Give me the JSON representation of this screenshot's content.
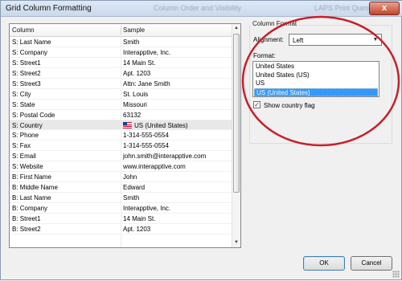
{
  "window": {
    "title": "Grid Column Formatting",
    "background_titles": [
      "Column Order and Visibility",
      "LAPS Print Quest"
    ],
    "close_symbol": "x"
  },
  "grid": {
    "headers": {
      "column": "Column",
      "sample": "Sample"
    },
    "rows": [
      {
        "column": "S: Last Name",
        "sample": "Smith"
      },
      {
        "column": "S: Company",
        "sample": "Interapptive, Inc."
      },
      {
        "column": "S: Street1",
        "sample": "14 Main St."
      },
      {
        "column": "S: Street2",
        "sample": "Apt. 1203"
      },
      {
        "column": "S: Street3",
        "sample": "Attn: Jane Smith"
      },
      {
        "column": "S: City",
        "sample": "St. Louis"
      },
      {
        "column": "S: State",
        "sample": "Missouri"
      },
      {
        "column": "S: Postal Code",
        "sample": "63132"
      },
      {
        "column": "S: Country",
        "sample": "US (United States)",
        "flag": "us-flag-icon"
      },
      {
        "column": "S: Phone",
        "sample": "1-314-555-0554"
      },
      {
        "column": "S: Fax",
        "sample": "1-314-555-0554"
      },
      {
        "column": "S: Email",
        "sample": "john.smith@interapptive.com"
      },
      {
        "column": "S: Website",
        "sample": "www.interapptive.com"
      },
      {
        "column": "B: First Name",
        "sample": "John"
      },
      {
        "column": "B: Middle Name",
        "sample": "Edward"
      },
      {
        "column": "B: Last Name",
        "sample": "Smith"
      },
      {
        "column": "B: Company",
        "sample": "Interapptive, Inc."
      },
      {
        "column": "B: Street1",
        "sample": "14 Main St."
      },
      {
        "column": "B: Street2",
        "sample": "Apt. 1203"
      }
    ],
    "selected_row": "S: Country"
  },
  "column_format": {
    "group_title": "Column Format",
    "alignment_label": "Alignment:",
    "alignment_value": "Left",
    "format_label": "Format:",
    "format_options": [
      "United States",
      "United States (US)",
      "US",
      "US (United States)"
    ],
    "format_selected": "US (United States)",
    "show_flag_label": "Show country flag",
    "show_flag_checked": true
  },
  "buttons": {
    "ok": "OK",
    "cancel": "Cancel"
  },
  "colors": {
    "selection": "#3399ff",
    "annotation_circle": "#c8202a"
  }
}
